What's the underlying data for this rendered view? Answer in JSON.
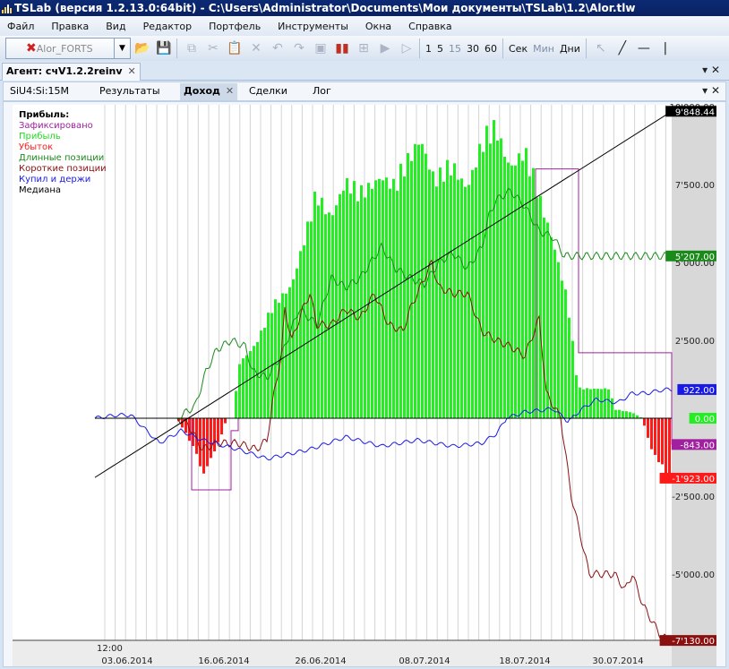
{
  "window": {
    "title": "TSLab (версия 1.2.13.0:64bit) - C:\\Users\\Administrator\\Documents\\Мои документы\\TSLab\\1.2\\Alor.tlw"
  },
  "menu": [
    "Файл",
    "Правка",
    "Вид",
    "Редактор",
    "Портфель",
    "Инструменты",
    "Окна",
    "Справка"
  ],
  "toolbar": {
    "connection": "Alor_FORTS",
    "intervals": [
      "1",
      "5",
      "15",
      "30",
      "60"
    ],
    "units": [
      "Сек",
      "Мин",
      "Дни"
    ]
  },
  "agent_tab": {
    "label": "Агент: счV1.2.2reinv"
  },
  "inner_tabs": [
    "SiU4:Si:15M",
    "Результаты",
    "Доход",
    "Сделки",
    "Лог"
  ],
  "active_tab": "Доход",
  "colors": {
    "fixed": "#a020a0",
    "profit": "#22ee22",
    "loss": "#ff1a1a",
    "long": "#1a8a1a",
    "short": "#8b1010",
    "buyhold": "#1a1ae6",
    "median": "#000000"
  },
  "chart_data": {
    "type": "bar",
    "title": "Прибыль:",
    "legend": [
      "Зафиксировано",
      "Прибыль",
      "Убыток",
      "Длинные позиции",
      "Короткие позиции",
      "Купил и держи",
      "Медиана"
    ],
    "x_range": [
      0,
      161
    ],
    "x_first_label": "12:00",
    "x_ticks": [
      {
        "x": 9,
        "label": "03.06.2014"
      },
      {
        "x": 36,
        "label": "16.06.2014"
      },
      {
        "x": 63,
        "label": "26.06.2014"
      },
      {
        "x": 92,
        "label": "08.07.2014"
      },
      {
        "x": 120,
        "label": "18.07.2014"
      },
      {
        "x": 146,
        "label": "30.07.2014"
      }
    ],
    "ylim": [
      -7200,
      10000
    ],
    "y_ticks": [
      {
        "v": 7500,
        "label": "7'500.00"
      },
      {
        "v": 5000,
        "label": "5'000.00"
      },
      {
        "v": 2500,
        "label": "2'500.00"
      },
      {
        "v": -2500,
        "label": "-2'500.00"
      },
      {
        "v": -5000,
        "label": "-5'000.00"
      },
      {
        "v": 10000,
        "label": "10'000.00"
      }
    ],
    "value_badges": [
      {
        "v": 9848.44,
        "label": "9'848.44",
        "color": "#000000"
      },
      {
        "v": 5207,
        "label": "5'207.00",
        "color": "#1a8a1a"
      },
      {
        "v": 922,
        "label": "922.00",
        "color": "#1a1ae6"
      },
      {
        "v": 0,
        "label": "0.00",
        "color": "#22ee22"
      },
      {
        "v": -843,
        "label": "-843.00",
        "color": "#a020a0"
      },
      {
        "v": -1923,
        "label": "-1'923.00",
        "color": "#ff1a1a"
      },
      {
        "v": -7130,
        "label": "-7'130.00",
        "color": "#8b1010"
      }
    ],
    "series": [
      {
        "name": "Прибыль",
        "kind": "bars",
        "points": [
          [
            0,
            0
          ],
          [
            39,
            0
          ],
          [
            40,
            1800
          ],
          [
            45,
            2500
          ],
          [
            50,
            3800
          ],
          [
            55,
            4500
          ],
          [
            62,
            7500
          ],
          [
            66,
            6800
          ],
          [
            70,
            8000
          ],
          [
            74,
            7500
          ],
          [
            80,
            8200
          ],
          [
            84,
            7800
          ],
          [
            88,
            8800
          ],
          [
            91,
            9500
          ],
          [
            95,
            8000
          ],
          [
            100,
            8500
          ],
          [
            104,
            7800
          ],
          [
            108,
            9200
          ],
          [
            112,
            9800
          ],
          [
            116,
            8500
          ],
          [
            120,
            9000
          ],
          [
            124,
            7500
          ],
          [
            128,
            6000
          ],
          [
            132,
            4000
          ],
          [
            135,
            1000
          ],
          [
            144,
            1000
          ],
          [
            145,
            300
          ],
          [
            150,
            200
          ],
          [
            153,
            0
          ],
          [
            161,
            0
          ]
        ]
      },
      {
        "name": "Убыток",
        "kind": "bars",
        "points": [
          [
            0,
            0
          ],
          [
            23,
            0
          ],
          [
            25,
            -400
          ],
          [
            29,
            -1300
          ],
          [
            30,
            -2000
          ],
          [
            32,
            -1500
          ],
          [
            35,
            -700
          ],
          [
            37,
            0
          ],
          [
            153,
            0
          ],
          [
            154,
            -500
          ],
          [
            156,
            -1200
          ],
          [
            158,
            -1500
          ],
          [
            160,
            -1923
          ],
          [
            161,
            -1923
          ]
        ]
      },
      {
        "name": "Длинные позиции",
        "kind": "line",
        "points": [
          [
            0,
            0
          ],
          [
            23,
            0
          ],
          [
            28,
            400
          ],
          [
            31,
            1500
          ],
          [
            34,
            2200
          ],
          [
            38,
            2500
          ],
          [
            42,
            2300
          ],
          [
            44,
            1500
          ],
          [
            48,
            1300
          ],
          [
            52,
            2000
          ],
          [
            57,
            3500
          ],
          [
            62,
            3000
          ],
          [
            66,
            4500
          ],
          [
            70,
            4200
          ],
          [
            74,
            4500
          ],
          [
            80,
            5500
          ],
          [
            84,
            4800
          ],
          [
            88,
            4500
          ],
          [
            92,
            4300
          ],
          [
            96,
            5000
          ],
          [
            100,
            5300
          ],
          [
            104,
            4800
          ],
          [
            108,
            5500
          ],
          [
            110,
            6500
          ],
          [
            112,
            7000
          ],
          [
            116,
            7300
          ],
          [
            120,
            6800
          ],
          [
            124,
            6000
          ],
          [
            128,
            5800
          ],
          [
            131,
            5207
          ],
          [
            161,
            5207
          ]
        ]
      },
      {
        "name": "Короткие позиции",
        "kind": "line",
        "points": [
          [
            0,
            0
          ],
          [
            23,
            0
          ],
          [
            26,
            -200
          ],
          [
            30,
            -1000
          ],
          [
            34,
            -800
          ],
          [
            40,
            -800
          ],
          [
            45,
            -1000
          ],
          [
            48,
            -700
          ],
          [
            50,
            800
          ],
          [
            52,
            2000
          ],
          [
            53,
            3500
          ],
          [
            55,
            2500
          ],
          [
            58,
            3500
          ],
          [
            60,
            4000
          ],
          [
            62,
            3000
          ],
          [
            66,
            3000
          ],
          [
            70,
            3500
          ],
          [
            74,
            3200
          ],
          [
            78,
            4000
          ],
          [
            82,
            3000
          ],
          [
            86,
            2800
          ],
          [
            88,
            3500
          ],
          [
            92,
            4500
          ],
          [
            94,
            5000
          ],
          [
            96,
            4200
          ],
          [
            100,
            4000
          ],
          [
            104,
            4000
          ],
          [
            108,
            2800
          ],
          [
            112,
            2500
          ],
          [
            116,
            2300
          ],
          [
            120,
            2000
          ],
          [
            124,
            3200
          ],
          [
            126,
            800
          ],
          [
            130,
            0
          ],
          [
            133,
            -2500
          ],
          [
            138,
            -5000
          ],
          [
            145,
            -5000
          ],
          [
            148,
            -5500
          ],
          [
            150,
            -5000
          ],
          [
            153,
            -6000
          ],
          [
            158,
            -7000
          ],
          [
            161,
            -7130
          ]
        ]
      },
      {
        "name": "Купил и держи",
        "kind": "line",
        "points": [
          [
            0,
            0
          ],
          [
            6,
            100
          ],
          [
            10,
            100
          ],
          [
            18,
            -800
          ],
          [
            24,
            -400
          ],
          [
            30,
            -700
          ],
          [
            40,
            -1000
          ],
          [
            48,
            -1300
          ],
          [
            52,
            -1200
          ],
          [
            60,
            -1000
          ],
          [
            70,
            -600
          ],
          [
            80,
            -900
          ],
          [
            90,
            -700
          ],
          [
            100,
            -900
          ],
          [
            108,
            -800
          ],
          [
            112,
            -500
          ],
          [
            115,
            0
          ],
          [
            120,
            200
          ],
          [
            128,
            300
          ],
          [
            132,
            -100
          ],
          [
            136,
            300
          ],
          [
            140,
            600
          ],
          [
            146,
            500
          ],
          [
            150,
            800
          ],
          [
            154,
            800
          ],
          [
            158,
            900
          ],
          [
            160,
            922
          ],
          [
            161,
            922
          ]
        ]
      },
      {
        "name": "Зафиксировано",
        "kind": "step",
        "points": [
          [
            0,
            0
          ],
          [
            24,
            0
          ],
          [
            27,
            -2300
          ],
          [
            37,
            -2300
          ],
          [
            38,
            -400
          ],
          [
            40,
            0
          ],
          [
            122,
            0
          ],
          [
            123,
            8000
          ],
          [
            134,
            8000
          ],
          [
            135,
            2100
          ],
          [
            160,
            2100
          ],
          [
            161,
            -843
          ]
        ]
      },
      {
        "name": "Медиана",
        "kind": "line",
        "points": [
          [
            0,
            -1900
          ],
          [
            161,
            9848.44
          ]
        ]
      }
    ]
  }
}
